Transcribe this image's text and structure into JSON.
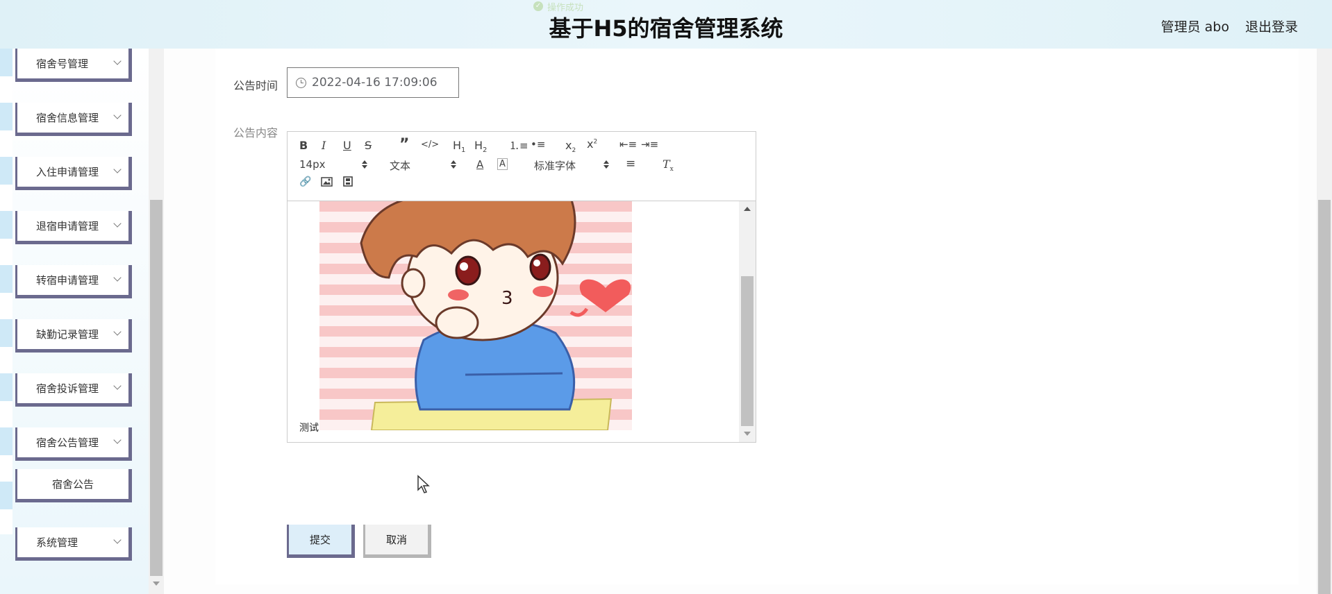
{
  "header": {
    "title": "基于H5的宿舍管理系统",
    "toast": "操作成功",
    "user": "管理员 abo",
    "logout": "退出登录"
  },
  "sidebar": {
    "items": [
      {
        "label": "宿舍号管理"
      },
      {
        "label": "宿舍信息管理"
      },
      {
        "label": "入住申请管理"
      },
      {
        "label": "退宿申请管理"
      },
      {
        "label": "转宿申请管理"
      },
      {
        "label": "缺勤记录管理"
      },
      {
        "label": "宿舍投诉管理"
      },
      {
        "label": "宿舍公告管理"
      },
      {
        "label": "宿舍公告"
      },
      {
        "label": "系统管理"
      }
    ]
  },
  "form": {
    "time_label": "公告时间",
    "time_value": "2022-04-16 17:09:06",
    "content_label": "公告内容",
    "submit_label": "提交",
    "cancel_label": "取消"
  },
  "editor": {
    "font_size": "14px",
    "text_type": "文本",
    "font_family": "标准字体",
    "caption": "测试"
  },
  "colors": {
    "button_border": "#6b6a8e",
    "submit_bg": "#ddeef9",
    "header_bg": "#dff1f7"
  }
}
